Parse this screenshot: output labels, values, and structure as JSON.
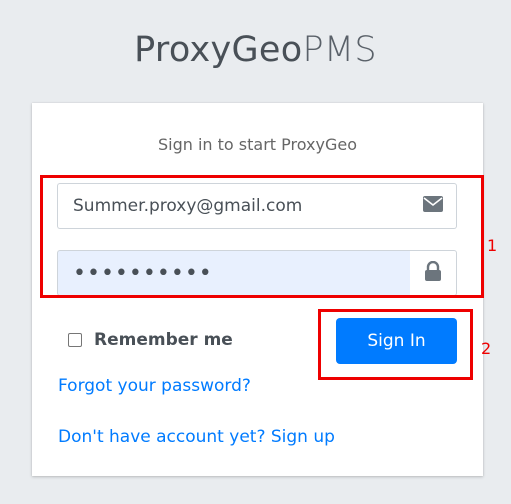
{
  "logo": {
    "bold": "ProxyGeo",
    "light": "PMS"
  },
  "login": {
    "message": "Sign in to start ProxyGeo",
    "email_value": "Summer.proxy@gmail.com",
    "password_value": "••••••••••",
    "email_icon": "envelope-icon",
    "password_icon": "lock-icon",
    "remember_label": "Remember me",
    "remember_checked": false,
    "signin_label": "Sign In",
    "forgot_link": "Forgot your password?",
    "signup_link": "Don't have account yet? Sign up"
  },
  "annotations": [
    {
      "label": "1",
      "color": "#ee0000"
    },
    {
      "label": "2",
      "color": "#ee0000"
    }
  ],
  "colors": {
    "accent": "#007bff",
    "highlight": "#ee0000",
    "background": "#e9ecef"
  }
}
